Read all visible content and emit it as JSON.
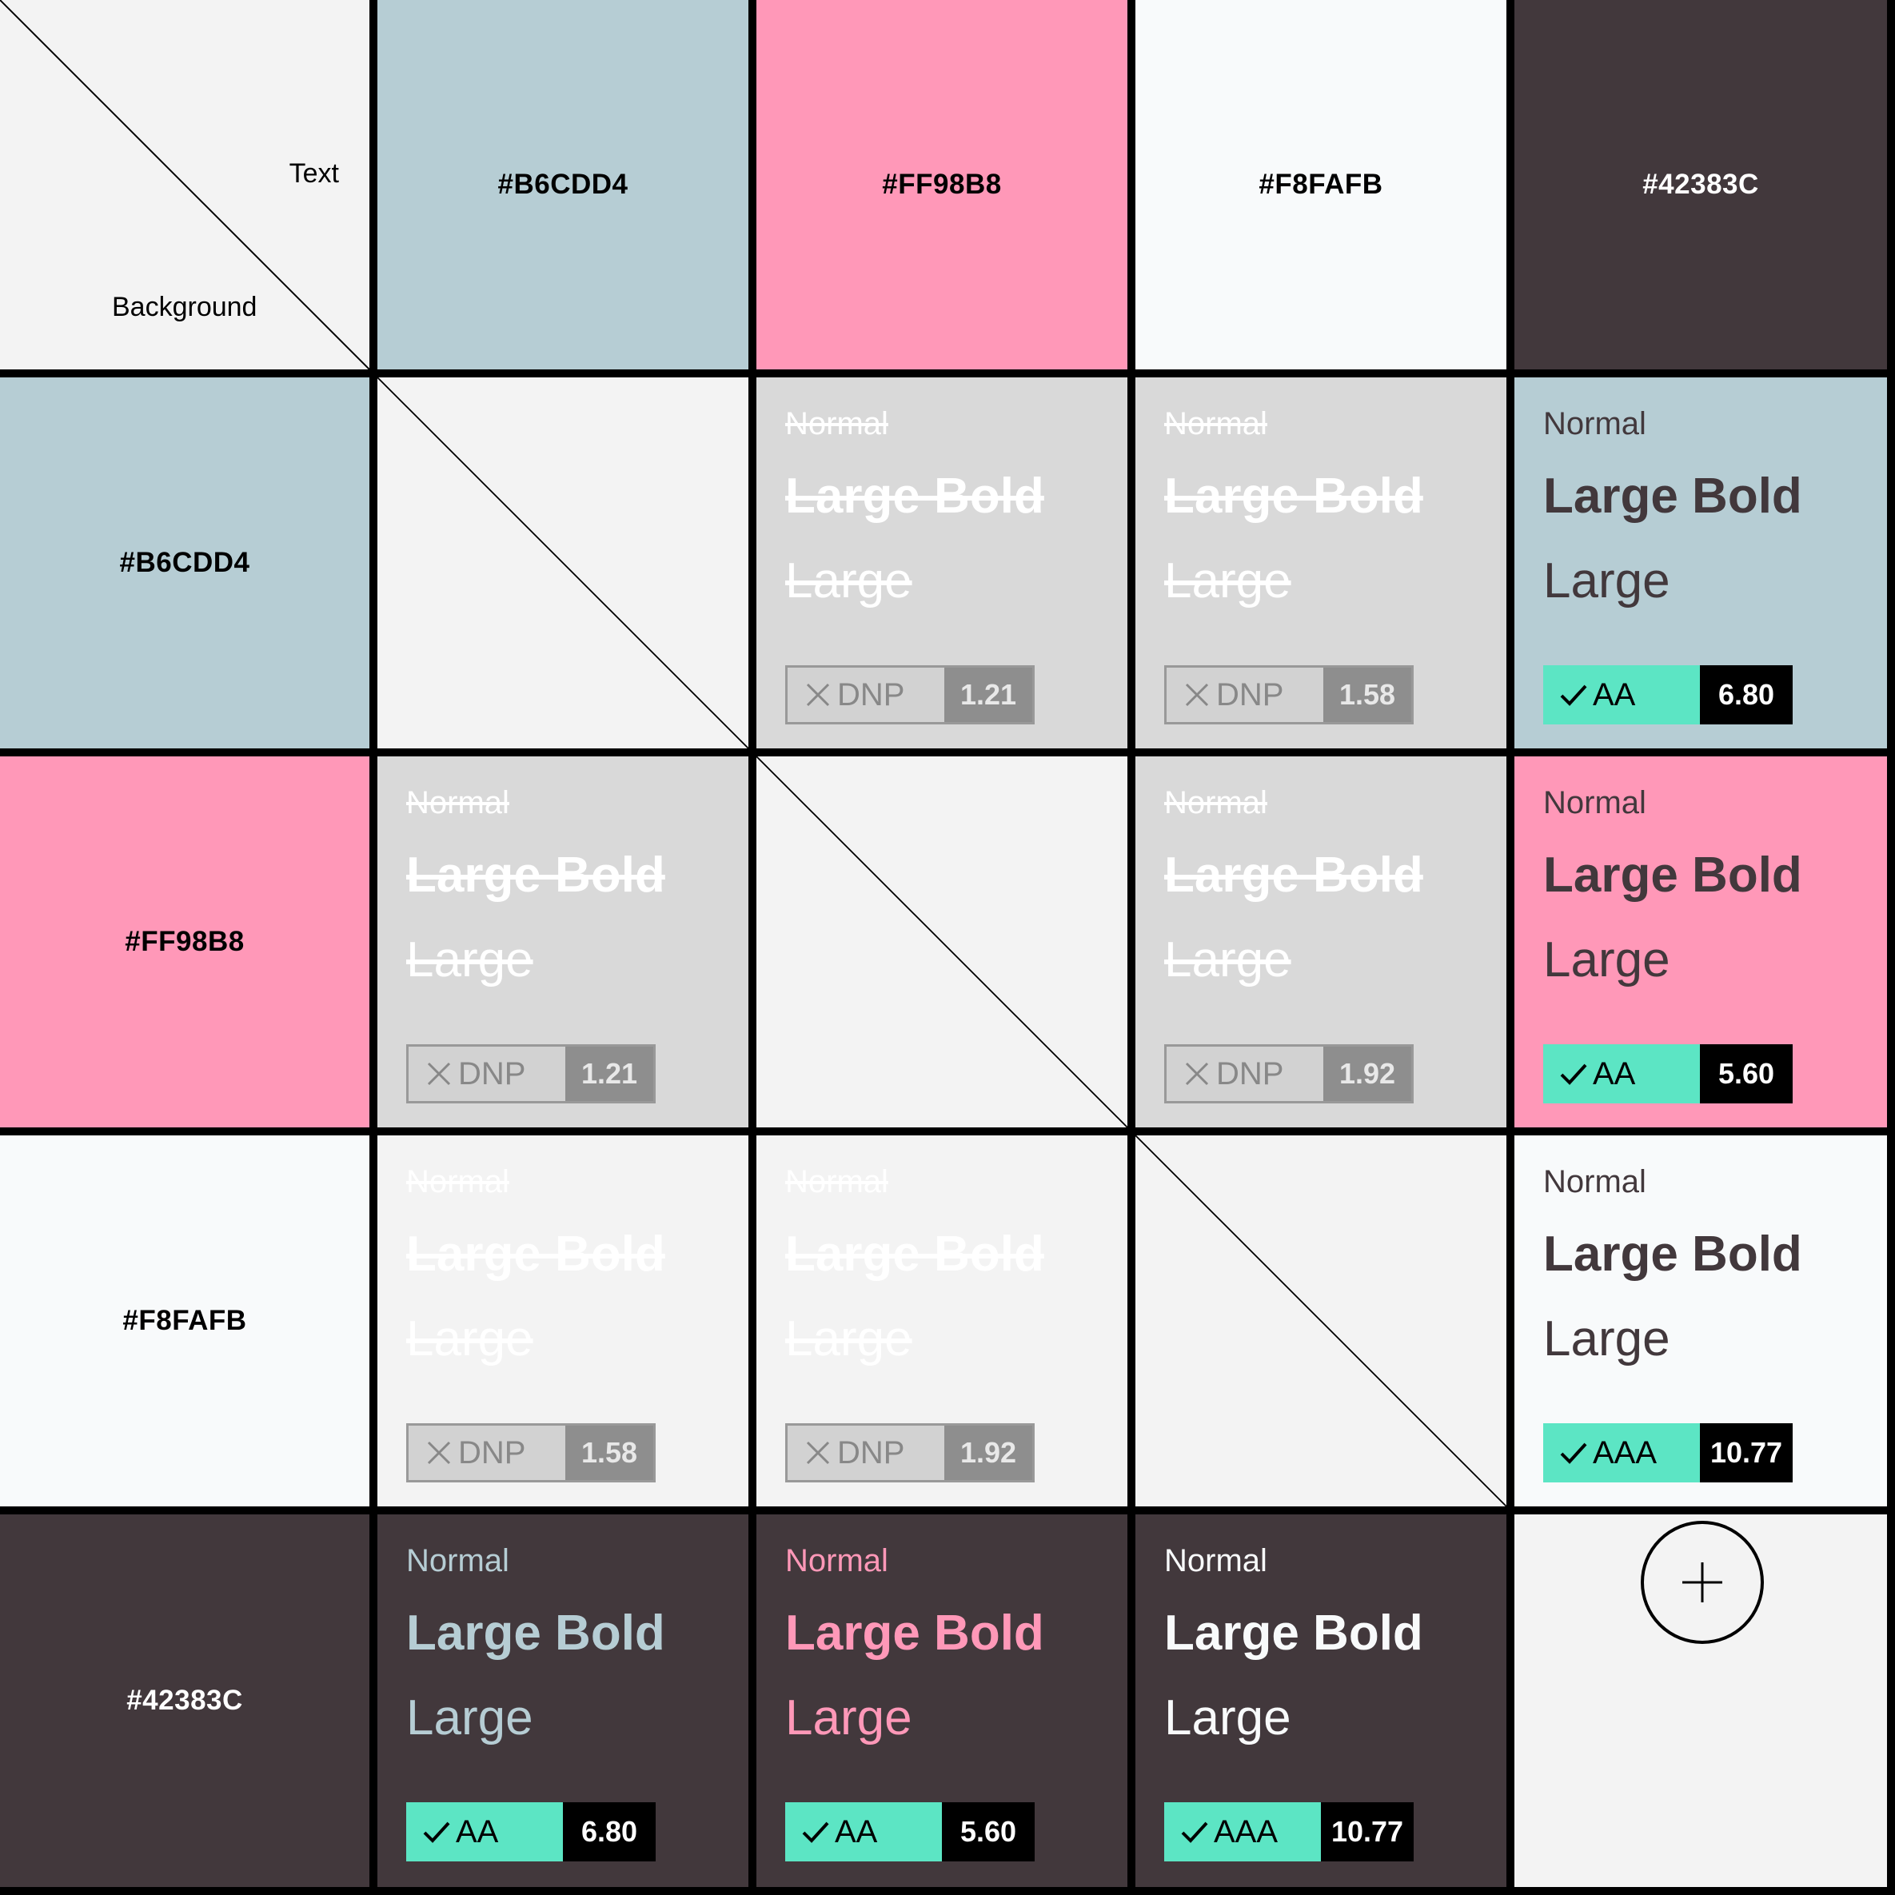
{
  "corner": {
    "text_label": "Text",
    "background_label": "Background"
  },
  "colors": [
    {
      "hex": "#B6CDD4",
      "label": "#B6CDD4",
      "label_color": "#000000"
    },
    {
      "hex": "#FF98B8",
      "label": "#FF98B8",
      "label_color": "#000000"
    },
    {
      "hex": "#F8FAFB",
      "label": "#F8FAFB",
      "label_color": "#000000"
    },
    {
      "hex": "#42383C",
      "label": "#42383C",
      "label_color": "#FFFFFF"
    }
  ],
  "sample_labels": {
    "normal": "Normal",
    "large_bold": "Large Bold",
    "large": "Large"
  },
  "matrix": [
    [
      null,
      {
        "pass": false,
        "rating": "DNP",
        "ratio": "1.21"
      },
      {
        "pass": false,
        "rating": "DNP",
        "ratio": "1.58"
      },
      {
        "pass": true,
        "rating": "AA",
        "ratio": "6.80"
      }
    ],
    [
      {
        "pass": false,
        "rating": "DNP",
        "ratio": "1.21"
      },
      null,
      {
        "pass": false,
        "rating": "DNP",
        "ratio": "1.92"
      },
      {
        "pass": true,
        "rating": "AA",
        "ratio": "5.60"
      }
    ],
    [
      {
        "pass": false,
        "rating": "DNP",
        "ratio": "1.58"
      },
      {
        "pass": false,
        "rating": "DNP",
        "ratio": "1.92"
      },
      null,
      {
        "pass": true,
        "rating": "AAA",
        "ratio": "10.77"
      }
    ],
    [
      {
        "pass": true,
        "rating": "AA",
        "ratio": "6.80"
      },
      {
        "pass": true,
        "rating": "AA",
        "ratio": "5.60"
      },
      {
        "pass": true,
        "rating": "AAA",
        "ratio": "10.77"
      },
      null
    ]
  ],
  "style": {
    "fail_cell_bg_on_light": "#F3F3F3",
    "fail_cell_bg_on_mid": "#D9D9D9",
    "fail_text_color": "#FFFFFF",
    "pass_badge_color": "#5CE5C4",
    "empty_cell_bg": "#F3F3F3"
  },
  "icons": {
    "pass": "check-icon",
    "fail": "x-icon",
    "add": "plus-icon"
  }
}
